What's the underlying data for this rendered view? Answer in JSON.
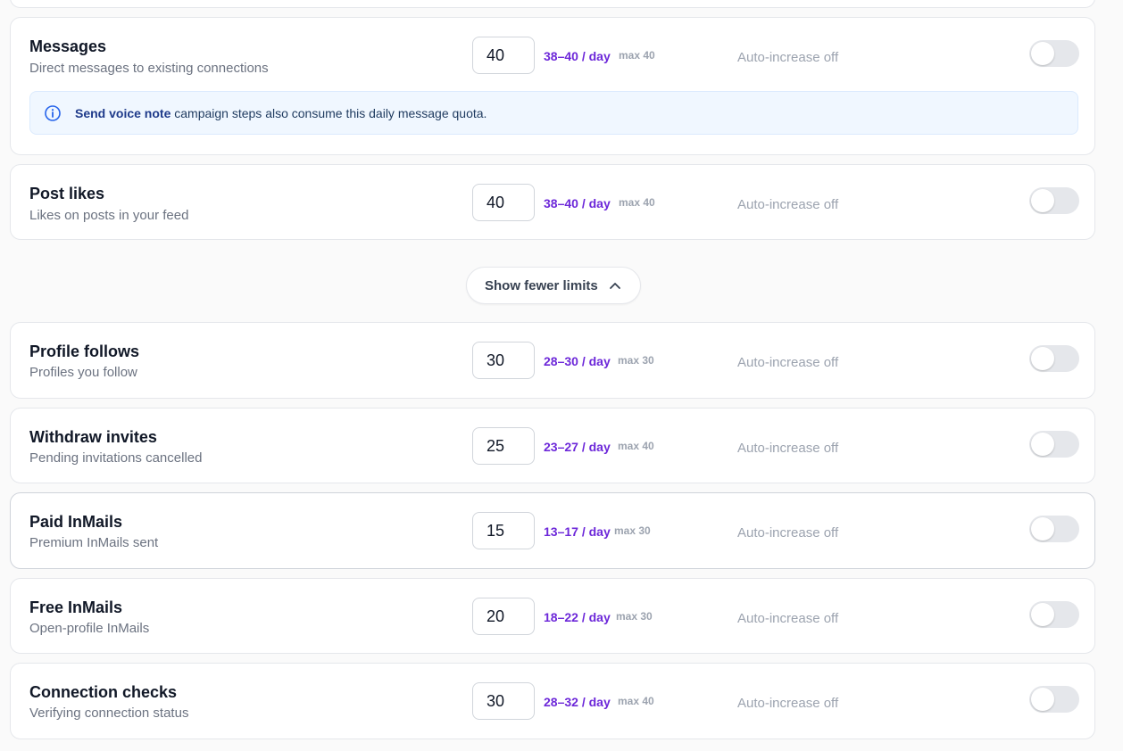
{
  "info_note": {
    "bold": "Send voice note",
    "rest": " campaign steps also consume this daily message quota."
  },
  "show_button": {
    "label": "Show fewer limits"
  },
  "limits": [
    {
      "title": "Messages",
      "subtitle": "Direct messages to existing connections",
      "value": "40",
      "range": "38–40 / day",
      "max": "max 40",
      "auto": "Auto-increase off",
      "enabled": false
    },
    {
      "title": "Post likes",
      "subtitle": "Likes on posts in your feed",
      "value": "40",
      "range": "38–40 / day",
      "max": "max 40",
      "auto": "Auto-increase off",
      "enabled": false
    },
    {
      "title": "Profile follows",
      "subtitle": "Profiles you follow",
      "value": "30",
      "range": "28–30 / day",
      "max": "max 30",
      "auto": "Auto-increase off",
      "enabled": false
    },
    {
      "title": "Withdraw invites",
      "subtitle": "Pending invitations cancelled",
      "value": "25",
      "range": "23–27 / day",
      "max": "max 40",
      "auto": "Auto-increase off",
      "enabled": false
    },
    {
      "title": "Paid InMails",
      "subtitle": "Premium InMails sent",
      "value": "15",
      "range": "13–17 / day",
      "max": "max 30",
      "auto": "Auto-increase off",
      "enabled": false
    },
    {
      "title": "Free InMails",
      "subtitle": "Open-profile InMails",
      "value": "20",
      "range": "18–22 / day",
      "max": "max 30",
      "auto": "Auto-increase off",
      "enabled": false
    },
    {
      "title": "Connection checks",
      "subtitle": "Verifying connection status",
      "value": "30",
      "range": "28–32 / day",
      "max": "max 40",
      "auto": "Auto-increase off",
      "enabled": false
    }
  ],
  "colors": {
    "accent": "#6d28d9",
    "info_bg": "#f0f7ff",
    "info_icon": "#2563eb"
  }
}
